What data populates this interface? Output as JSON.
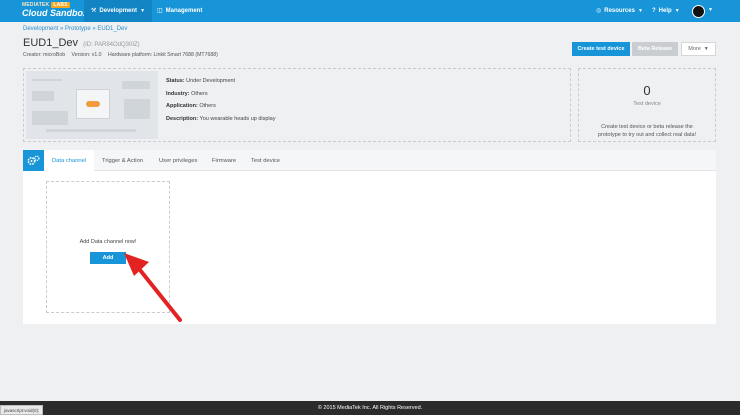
{
  "navbar": {
    "logo_top": "MEDIATEK",
    "logo_badge": "LABS",
    "logo_main": "Cloud Sandbox",
    "development_label": "Development",
    "management_label": "Management",
    "resources_label": "Resources",
    "help_label": "Help"
  },
  "breadcrumb": "Development » Prototype » EUD1_Dev",
  "prototype": {
    "name": "EUD1_Dev",
    "id_text": "(ID: PAR84OdQ30IZ)",
    "creator": "Creator: microBob",
    "version": "Version: v1.0",
    "platform": "Hardware platform: Linkit Smart 7688 (MT7688)"
  },
  "actions": {
    "create_test_device": "Create test device",
    "beta_release": "Beta Release",
    "more": "More"
  },
  "info": {
    "status_label": "Status:",
    "status_value": "Under Development",
    "industry_label": "Industry:",
    "industry_value": "Others",
    "application_label": "Application:",
    "application_value": "Others",
    "description_label": "Description:",
    "description_value": "You wearable heads up display"
  },
  "test_device": {
    "count": "0",
    "label": "Test device",
    "description": "Create test device or beta release the prototype to try out and collect real data!"
  },
  "tabs": [
    "Data channel",
    "Trigger & Action",
    "User privileges",
    "Firmware",
    "Test device"
  ],
  "data_channel": {
    "prompt": "Add Data channel now!",
    "add_button": "Add"
  },
  "footer": "© 2015 MediaTek Inc. All Rights Reserved.",
  "status_url": "javascript:void(0);",
  "colors": {
    "primary": "#1795d8",
    "arrow": "#e32222",
    "footer": "#2b2b2b"
  }
}
